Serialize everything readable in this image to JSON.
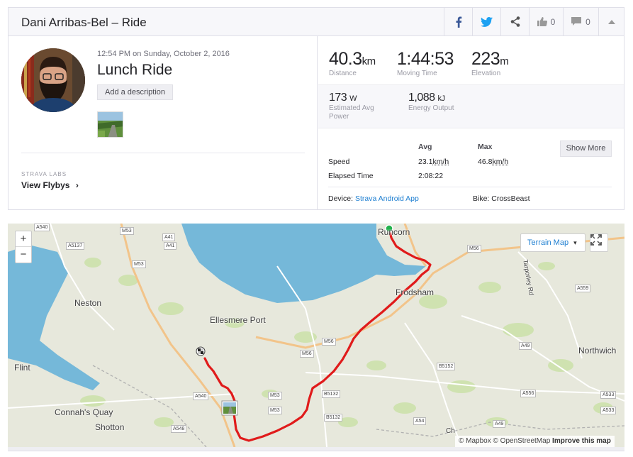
{
  "header": {
    "title": "Dani Arribas-Bel – Ride",
    "kudos_count": "0",
    "comment_count": "0",
    "icons": [
      "facebook-icon",
      "twitter-icon",
      "share-icon",
      "thumbs-up-icon",
      "comment-icon",
      "chevron-up-icon"
    ]
  },
  "activity": {
    "datetime": "12:54 PM on Sunday, October 2, 2016",
    "name": "Lunch Ride",
    "add_description": "Add a description",
    "labs_label": "STRAVA LABS",
    "flyby_link": "View Flybys",
    "flyby_chevron": "›"
  },
  "stats": {
    "distance": {
      "value": "40.3",
      "unit": "km",
      "label": "Distance"
    },
    "moving_time": {
      "value": "1:44:53",
      "label": "Moving Time"
    },
    "elevation": {
      "value": "223",
      "unit": "m",
      "label": "Elevation"
    },
    "power": {
      "value": "173",
      "unit": "W",
      "label": "Estimated Avg Power"
    },
    "energy": {
      "value": "1,088",
      "unit": "kJ",
      "label": "Energy Output"
    }
  },
  "details": {
    "col_avg": "Avg",
    "col_max": "Max",
    "speed_label": "Speed",
    "speed_avg": "23.1",
    "speed_max": "46.8",
    "speed_unit": "km/h",
    "elapsed_label": "Elapsed Time",
    "elapsed_avg": "2:08:22",
    "show_more": "Show More",
    "device_label": "Device:",
    "device_value": "Strava Android App",
    "bike_label": "Bike:",
    "bike_value": "CrossBeast"
  },
  "map": {
    "zoom_in": "+",
    "zoom_out": "−",
    "terrain_label": "Terrain Map",
    "terrain_caret": "▾",
    "attribution_mapbox": "© Mapbox",
    "attribution_osm": "© OpenStreetMap",
    "attribution_improve": "Improve this map",
    "places": {
      "runcorn": "Runcorn",
      "neston": "Neston",
      "frodsham": "Frodsham",
      "ellesmere_port": "Ellesmere Port",
      "northwich": "Northwich",
      "flint": "Flint",
      "connahs_quay": "Connah's Quay",
      "shotton": "Shotton",
      "tarporley_rd": "Tarporley Rd",
      "ch": "Ch"
    },
    "roads": {
      "a540_top": "A540",
      "m53_top": "M53",
      "a41_a": "A41",
      "a41_b": "A41",
      "a5137": "A5137",
      "m53_mid": "M53",
      "m56_top": "M56",
      "a559": "A559",
      "m56_a": "M56",
      "m56_b": "M56",
      "a49_a": "A49",
      "b5152": "B5152",
      "b5132_a": "B5132",
      "b5132_b": "B5132",
      "a540_low": "A540",
      "m53_low_a": "M53",
      "m53_low_b": "M53",
      "a556": "A556",
      "a533_a": "A533",
      "a533_b": "A533",
      "a548": "A548",
      "a54": "A54",
      "a49_b": "A49"
    },
    "colors": {
      "route": "#e01b1b",
      "water": "#75b8d9",
      "land": "#e7e8dc",
      "park": "#c9dfa8",
      "start": "#22b14c"
    }
  }
}
